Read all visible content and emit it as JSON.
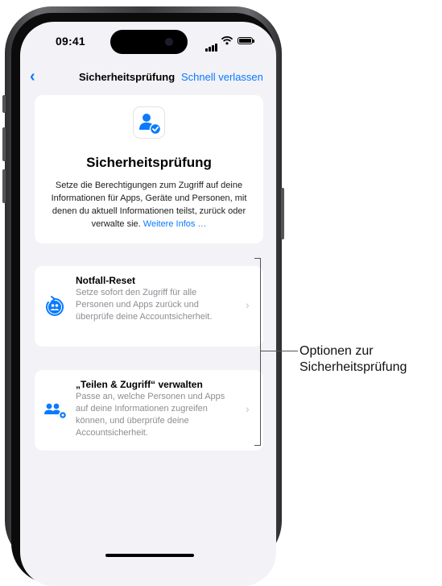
{
  "status_bar": {
    "time": "09:41"
  },
  "nav": {
    "back_glyph": "‹",
    "title": "Sicherheitsprüfung",
    "action": "Schnell verlassen"
  },
  "hero": {
    "icon": "person-checkmark-icon",
    "title": "Sicherheitsprüfung",
    "description": "Setze die Berechtigungen zum Zugriff auf deine Informationen für Apps, Geräte und Personen, mit denen du aktuell Informationen teilst, zurück oder verwalte sie.",
    "link": "Weitere Infos …"
  },
  "options": [
    {
      "icon": "reset-people-icon",
      "title": "Notfall-Reset",
      "description": "Setze sofort den Zugriff für alle Personen und Apps zurück und überprüfe deine Accountsicher­heit."
    },
    {
      "icon": "people-gear-icon",
      "title": "„Teilen & Zugriff“ verwalten",
      "description": "Passe an, welche Personen und Apps auf deine Informationen zugreifen können, und überprüfe deine Accountsicherheit."
    }
  ],
  "chevron": "›",
  "callout": {
    "line1": "Optionen zur",
    "line2": "Sicherheitsprüfung"
  },
  "colors": {
    "accent": "#0a7aff",
    "background": "#f2f2f7",
    "secondary_text": "#8e8e93"
  }
}
